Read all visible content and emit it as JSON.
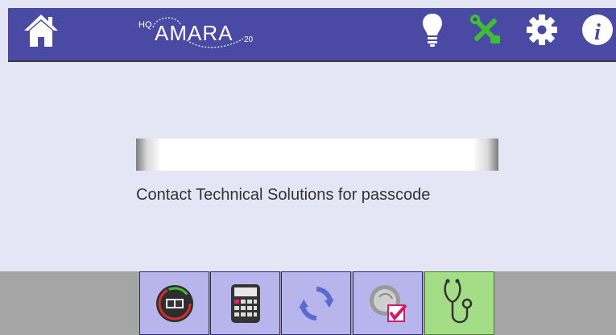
{
  "header": {
    "logo_text": "AMARA",
    "logo_prefix": "HQ",
    "logo_suffix": "20",
    "icons": [
      "home-icon",
      "lightbulb-icon",
      "tools-icon",
      "gear-icon",
      "info-icon"
    ]
  },
  "passcode": {
    "value": "",
    "placeholder": ""
  },
  "hint": "Contact Technical Solutions for passcode",
  "toolbar": {
    "buttons": [
      {
        "icon": "meter-icon",
        "active": false
      },
      {
        "icon": "calculator-icon",
        "active": false
      },
      {
        "icon": "refresh-icon",
        "active": false
      },
      {
        "icon": "checklist-icon",
        "active": false
      },
      {
        "icon": "stethoscope-icon",
        "active": true
      }
    ]
  },
  "colors": {
    "header_bg": "#4a4aa4",
    "content_bg": "#e4e6f5",
    "footer_bg": "#a5a5a5",
    "button_bg": "#b8b4ec",
    "active_button_bg": "#a3dd86",
    "tools_icon": "#3fbe34"
  }
}
